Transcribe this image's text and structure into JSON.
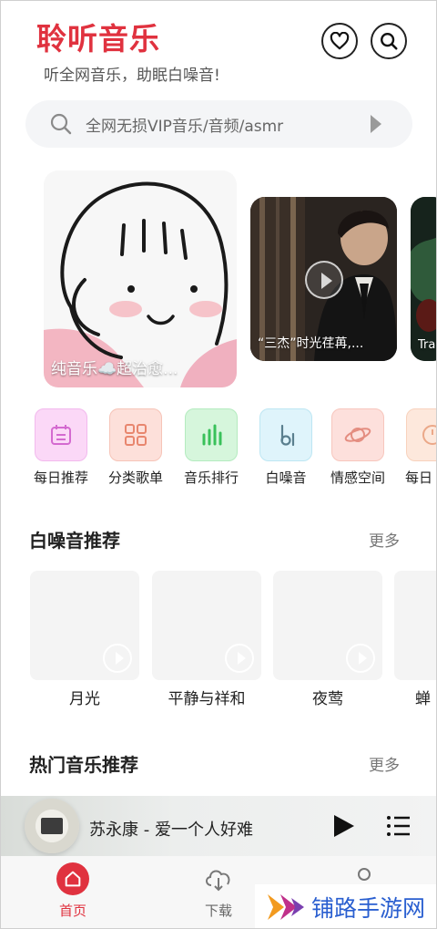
{
  "header": {
    "title": "聆听音乐",
    "subtitle": "听全网音乐，助眠白噪音!"
  },
  "search": {
    "placeholder": "全网无损VIP音乐/音频/asmr"
  },
  "banners": [
    {
      "label": "纯音乐☁️超治愈..."
    },
    {
      "label": "“三杰”时光荏苒,..."
    },
    {
      "label": "Tra"
    }
  ],
  "quick_actions": [
    {
      "label": "每日推荐",
      "icon": "calendar-icon",
      "bg": "#fbd8f7",
      "fg": "#d46ad0"
    },
    {
      "label": "分类歌单",
      "icon": "grid-icon",
      "bg": "#fde0da",
      "fg": "#e8866e"
    },
    {
      "label": "音乐排行",
      "icon": "bar-chart-icon",
      "bg": "#d6f6dc",
      "fg": "#39c15a"
    },
    {
      "label": "白噪音",
      "icon": "music-note-icon",
      "bg": "#dff4fb",
      "fg": "#5a7f8e"
    },
    {
      "label": "情感空间",
      "icon": "planet-icon",
      "bg": "#fde0dc",
      "fg": "#e48d80"
    },
    {
      "label": "每日",
      "icon": "clock-icon",
      "bg": "#fde8dc",
      "fg": "#eba888"
    }
  ],
  "white_noise": {
    "title": "白噪音推荐",
    "more": "更多",
    "items": [
      {
        "label": "月光"
      },
      {
        "label": "平静与祥和"
      },
      {
        "label": "夜莺"
      },
      {
        "label": "蝉"
      }
    ]
  },
  "hot_music": {
    "title": "热门音乐推荐",
    "more": "更多"
  },
  "player": {
    "now_playing": "苏永康 - 爱一个人好难"
  },
  "tabs": [
    {
      "label": "首页",
      "icon": "home-icon",
      "active": true
    },
    {
      "label": "下载",
      "icon": "cloud-download-icon",
      "active": false
    },
    {
      "label": "",
      "icon": "user-icon",
      "active": false
    }
  ],
  "watermark": {
    "text": "铺路手游网"
  },
  "colors": {
    "accent": "#e0323f",
    "watermark_blue": "#2a5fd0"
  }
}
